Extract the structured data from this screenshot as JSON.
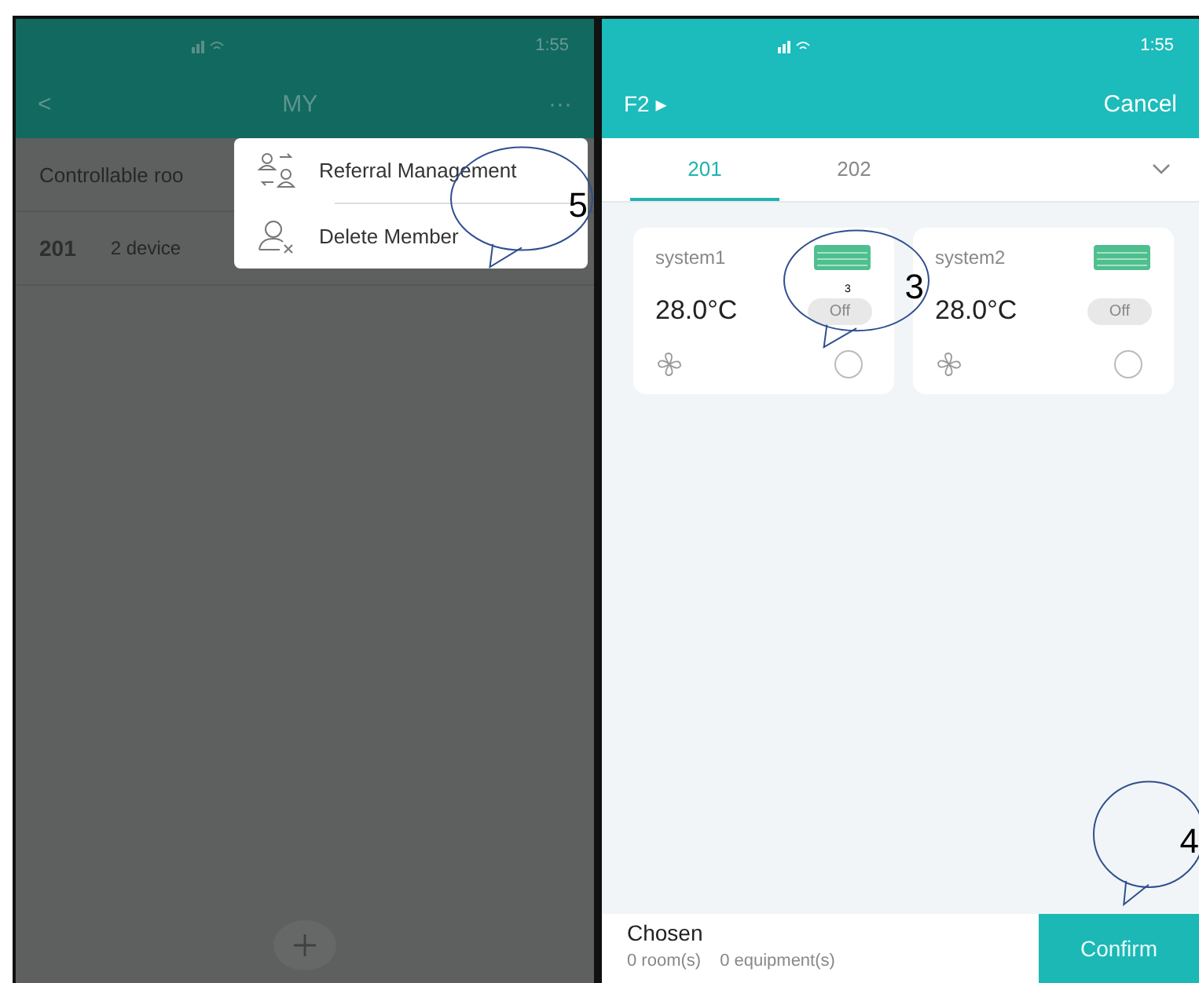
{
  "left": {
    "status_bar": {
      "time": "1:55"
    },
    "header": {
      "back": "<",
      "title": "MY",
      "more": "···"
    },
    "rooms_heading": "Controllable roo",
    "rooms": [
      {
        "number": "201",
        "devices": "2 device"
      }
    ],
    "menu": {
      "items": [
        {
          "kind": "referral",
          "label": "Referral Management"
        },
        {
          "kind": "delete",
          "label": "Delete Member"
        }
      ]
    }
  },
  "right": {
    "status_bar": {
      "time": "1:55"
    },
    "header": {
      "floor": "F2",
      "floor_arrow": "▸",
      "cancel": "Cancel"
    },
    "tabs": [
      {
        "label": "201",
        "selected": true
      },
      {
        "label": "202",
        "selected": false
      }
    ],
    "devices": [
      {
        "name": "system1",
        "temperature": "28.0°C",
        "mode": "Off",
        "selected": false
      },
      {
        "name": "system2",
        "temperature": "28.0°C",
        "mode": "Off",
        "selected": false
      }
    ],
    "footer": {
      "title": "Chosen",
      "rooms": "0 room(s)",
      "equipment": "0 equipment(s)",
      "confirm": "Confirm"
    }
  },
  "callouts": [
    {
      "number": "5"
    },
    {
      "number": "3",
      "note": "3"
    },
    {
      "number": "4"
    }
  ]
}
